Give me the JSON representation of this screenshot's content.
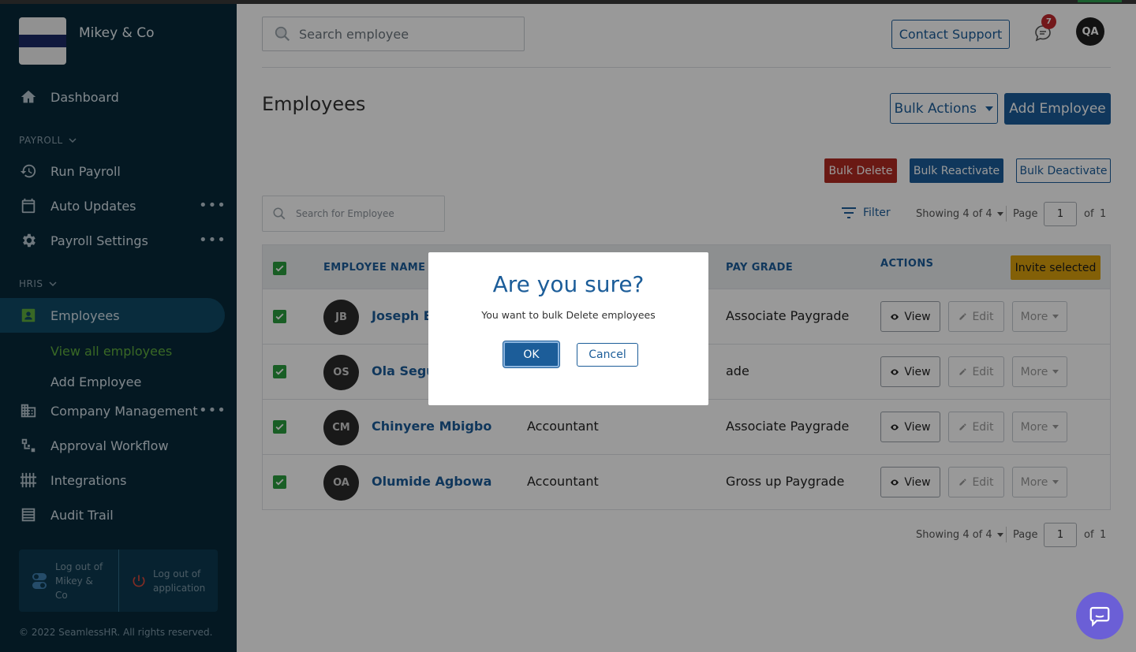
{
  "org": {
    "name": "Mikey & Co"
  },
  "sidebar": {
    "dashboard": "Dashboard",
    "payroll_section": "PAYROLL",
    "run_payroll": "Run Payroll",
    "auto_updates": "Auto Updates",
    "payroll_settings": "Payroll Settings",
    "hris_section": "HRIS",
    "employees": "Employees",
    "view_all_employees": "View all employees",
    "add_employee": "Add Employee",
    "company_management": "Company Management",
    "approval_workflow": "Approval Workflow",
    "integrations": "Integrations",
    "audit_trail": "Audit Trail",
    "more_glyph": "•••",
    "logout_org": "Log out of Mikey & Co",
    "logout_app": "Log out of application",
    "copyright": "© 2022 SeamlessHR. All rights reserved."
  },
  "header": {
    "search_placeholder": "Search employee",
    "contact_support": "Contact Support",
    "notification_count": "7",
    "user_initials": "QA"
  },
  "page": {
    "title": "Employees",
    "bulk_actions": "Bulk Actions",
    "add_employee": "Add Employee",
    "bulk_delete": "Bulk Delete",
    "bulk_reactivate": "Bulk Reactivate",
    "bulk_deactivate": "Bulk Deactivate",
    "table_search_placeholder": "Search for Employee",
    "filter": "Filter",
    "showing": "Showing 4 of 4",
    "page_label": "Page",
    "page_number": "1",
    "of_label": "of",
    "total_pages": "1"
  },
  "table": {
    "columns": {
      "name": "EMPLOYEE NAME",
      "grade": "PAY GRADE",
      "actions": "ACTIONS"
    },
    "invite_selected": "Invite selected",
    "view": "View",
    "edit": "Edit",
    "more": "More",
    "rows": [
      {
        "initials": "JB",
        "name": "Joseph B",
        "role": "",
        "grade": "Associate Paygrade"
      },
      {
        "initials": "OS",
        "name": "Ola Segun",
        "role": "",
        "grade": "ade"
      },
      {
        "initials": "CM",
        "name": "Chinyere Mbigbo",
        "role": "Accountant",
        "grade": "Associate Paygrade"
      },
      {
        "initials": "OA",
        "name": "Olumide Agbowa",
        "role": "Accountant",
        "grade": "Gross up Paygrade"
      }
    ]
  },
  "modal": {
    "title": "Are you sure?",
    "message": "You want to bulk Delete employees",
    "ok": "OK",
    "cancel": "Cancel"
  },
  "colors": {
    "sidebar_bg": "#07293a",
    "primary": "#1c5d99",
    "danger": "#b12a22",
    "warning": "#dba10c",
    "success": "#2a9d3f"
  }
}
